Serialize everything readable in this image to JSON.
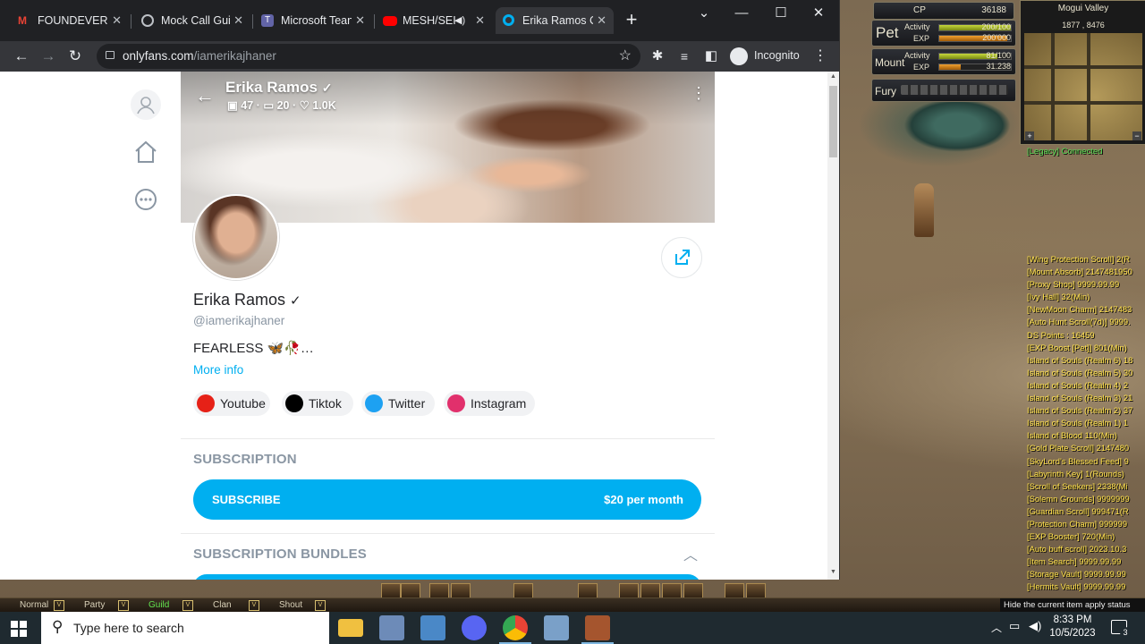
{
  "browser": {
    "tabs": [
      {
        "label": "FOUNDEVER: I",
        "icon": "gmail-icon"
      },
      {
        "label": "Mock Call Gui",
        "icon": "globe-icon"
      },
      {
        "label": "Microsoft Tean",
        "icon": "teams-icon"
      },
      {
        "label": "MESH/SEI",
        "icon": "youtube-icon"
      },
      {
        "label": "Erika Ramos C",
        "icon": "onlyfans-icon",
        "active": true
      }
    ],
    "new_tab_label": "+",
    "address": {
      "domain": "onlyfans.com",
      "path": "/iamerikajhaner"
    },
    "profile_label": "Incognito"
  },
  "profile": {
    "cover_name": "Erika Ramos",
    "photos_count": "47",
    "videos_count": "20",
    "likes_count": "1.0K",
    "name": "Erika Ramos",
    "handle": "@iamerikajhaner",
    "bio": "FEARLESS 🦋🥀…",
    "more_info": "More info",
    "socials": [
      {
        "label": "Youtube",
        "color": "#e62117"
      },
      {
        "label": "Tiktok",
        "color": "#000000"
      },
      {
        "label": "Twitter",
        "color": "#1da1f2"
      },
      {
        "label": "Instagram",
        "color": "#e1306c"
      }
    ],
    "subscription_title": "SUBSCRIPTION",
    "subscribe_label": "SUBSCRIBE",
    "subscribe_price": "$20 per month",
    "bundles_title": "SUBSCRIPTION BUNDLES"
  },
  "game": {
    "cp_label": "CP",
    "cp_value": "36188",
    "pet_label": "Pet",
    "pet_activity_label": "Activity",
    "pet_activity_value": "200/100",
    "pet_activity_fraction": 1.0,
    "pet_exp_label": "EXP",
    "pet_exp_value": "200'000",
    "pet_exp_fraction": 0.95,
    "mount_label": "Mount",
    "mount_activity_label": "Activity",
    "mount_activity_value": "81/100",
    "mount_activity_fraction": 0.81,
    "mount_exp_label": "EXP",
    "mount_exp_value": "31.238",
    "mount_exp_fraction": 0.3,
    "fury_label": "Fury",
    "map_name": "Mogui Valley",
    "map_coords": "1877 , 8476",
    "status_text": "[Legacy] Connected",
    "chat_lines": [
      "[Wing Protection Scroll] 2(R",
      "[Mount Absorb] 2147481950",
      "[Proxy Shop] 9999.99.99",
      "[Ivy Hall] 32(Min)",
      "[NewMoon Charm] 2147483",
      "[Auto Hunt Scroll(7d)] 9999.",
      "DS Points : 16459",
      "[EXP Boost [Pet]] 801(Min)",
      "Island of Souls (Realm 6) 18",
      "Island of Souls (Realm 5) 30",
      "Island of Souls (Realm 4) 2",
      "Island of Souls (Realm 3) 21",
      "Island of Souls (Realm 2) 37",
      "Island of Souls (Realm 1) 1",
      "Island of Blood 110(Min)",
      "[Gold Plate Scroll] 2147480",
      "[SkyLord's Blessed Feed] 9",
      "[Labyrinth Key] 1(Rounds)",
      "[Scroll of Seekers] 2338(Mi",
      "[Solemn Grounds] 9999999",
      "[Guardian Scroll] 999471(R",
      "[Protection Charm] 999999",
      "[EXP Booster] 720(Min)",
      "[Auto buff scroll] 2023.10.3",
      "[Item Search] 9999.99.99",
      "[Storage Vault] 9999.99.99",
      "[Hermits Vault] 9999.99.99"
    ],
    "chat_tabs": [
      "Normal",
      "Party",
      "Guild",
      "Clan",
      "Shout"
    ],
    "tooltip": "Hide the current item apply status"
  },
  "taskbar": {
    "search_placeholder": "Type here to search",
    "time": "8:33 PM",
    "date": "10/5/2023",
    "notification_count": "3"
  }
}
